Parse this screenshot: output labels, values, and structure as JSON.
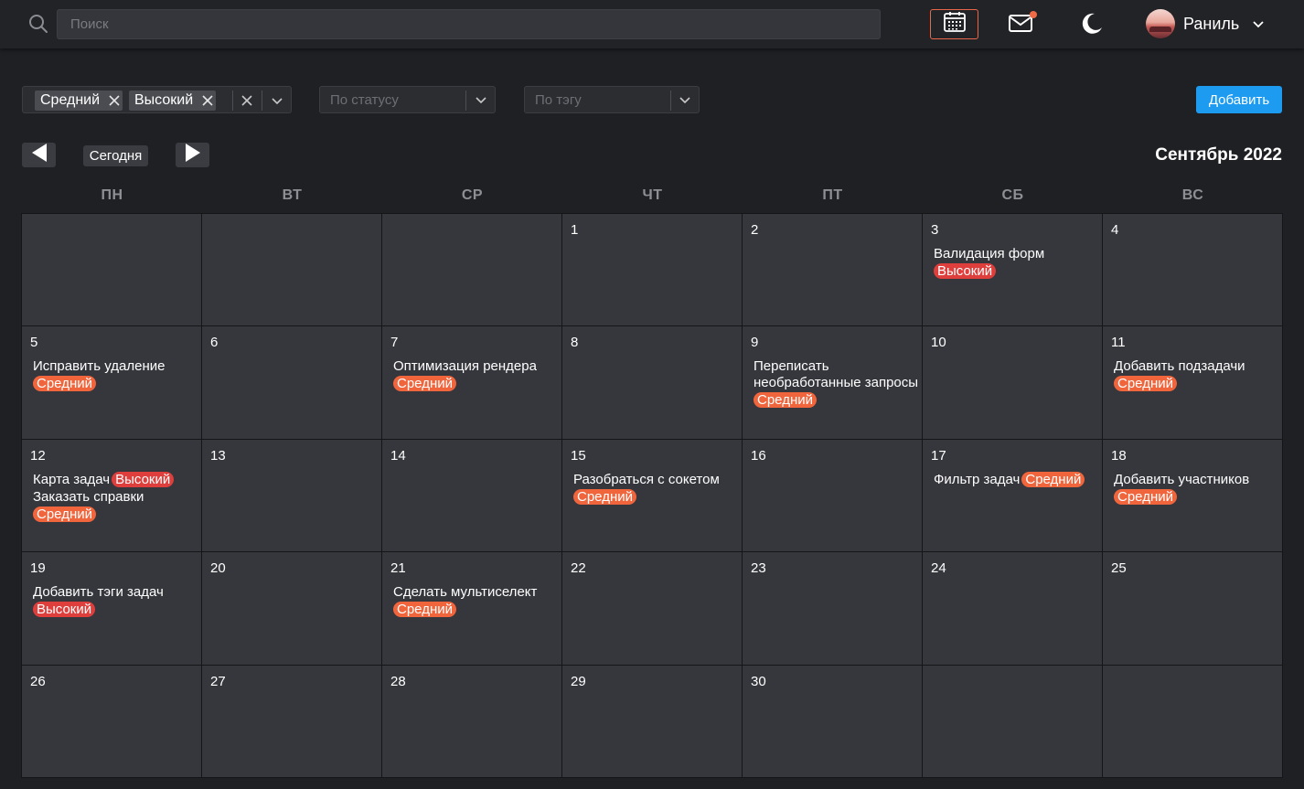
{
  "header": {
    "search_placeholder": "Поиск",
    "user_name": "Раниль",
    "icons": [
      "search-icon",
      "calendar-icon",
      "mail-icon",
      "moon-icon",
      "chevron-down-icon"
    ]
  },
  "filters": {
    "priority_chips": [
      "Средний",
      "Высокий"
    ],
    "status_placeholder": "По статусу",
    "tag_placeholder": "По тэгу",
    "add_label": "Добавить"
  },
  "nav": {
    "today_label": "Сегодня",
    "month_title": "Сентябрь 2022"
  },
  "calendar": {
    "weekdays": [
      "ПН",
      "ВТ",
      "СР",
      "ЧТ",
      "ПТ",
      "СБ",
      "ВС"
    ],
    "days": [
      {
        "day": ""
      },
      {
        "day": ""
      },
      {
        "day": ""
      },
      {
        "day": "1"
      },
      {
        "day": "2"
      },
      {
        "day": "3",
        "events": [
          {
            "title": "Валидация форм",
            "priority": "Высокий",
            "level": "high"
          }
        ]
      },
      {
        "day": "4"
      },
      {
        "day": "5",
        "events": [
          {
            "title": "Исправить удаление",
            "priority": "Средний",
            "level": "mid"
          }
        ]
      },
      {
        "day": "6"
      },
      {
        "day": "7",
        "events": [
          {
            "title": "Оптимизация рендера",
            "priority": "Средний",
            "level": "mid"
          }
        ]
      },
      {
        "day": "8"
      },
      {
        "day": "9",
        "events": [
          {
            "title": "Переписать необработанные запросы",
            "priority": "Средний",
            "level": "mid"
          }
        ]
      },
      {
        "day": "10"
      },
      {
        "day": "11",
        "events": [
          {
            "title": "Добавить подзадачи",
            "priority": "Средний",
            "level": "mid"
          }
        ]
      },
      {
        "day": "12",
        "events": [
          {
            "title": "Карта задач",
            "priority": "Высокий",
            "level": "high",
            "inline": true
          },
          {
            "title": "Заказать справки",
            "priority": "Средний",
            "level": "mid"
          }
        ]
      },
      {
        "day": "13"
      },
      {
        "day": "14"
      },
      {
        "day": "15",
        "events": [
          {
            "title": "Разобраться с сокетом",
            "priority": "Средний",
            "level": "mid"
          }
        ]
      },
      {
        "day": "16"
      },
      {
        "day": "17",
        "events": [
          {
            "title": "Фильтр задач",
            "priority": "Средний",
            "level": "mid",
            "inline": true
          }
        ]
      },
      {
        "day": "18",
        "events": [
          {
            "title": "Добавить участников",
            "priority": "Средний",
            "level": "mid"
          }
        ]
      },
      {
        "day": "19",
        "events": [
          {
            "title": "Добавить тэги задач",
            "priority": "Высокий",
            "level": "high"
          }
        ]
      },
      {
        "day": "20"
      },
      {
        "day": "21",
        "events": [
          {
            "title": "Сделать мультиселект",
            "priority": "Средний",
            "level": "mid"
          }
        ]
      },
      {
        "day": "22"
      },
      {
        "day": "23"
      },
      {
        "day": "24"
      },
      {
        "day": "25"
      },
      {
        "day": "26"
      },
      {
        "day": "27"
      },
      {
        "day": "28"
      },
      {
        "day": "29"
      },
      {
        "day": "30"
      },
      {
        "day": ""
      },
      {
        "day": ""
      }
    ]
  },
  "colors": {
    "accent": "#1d9bf0",
    "priority_high": "#df3f3c",
    "priority_mid": "#f1653d",
    "cell_bg": "#35373c",
    "page_bg": "#1f2024"
  }
}
